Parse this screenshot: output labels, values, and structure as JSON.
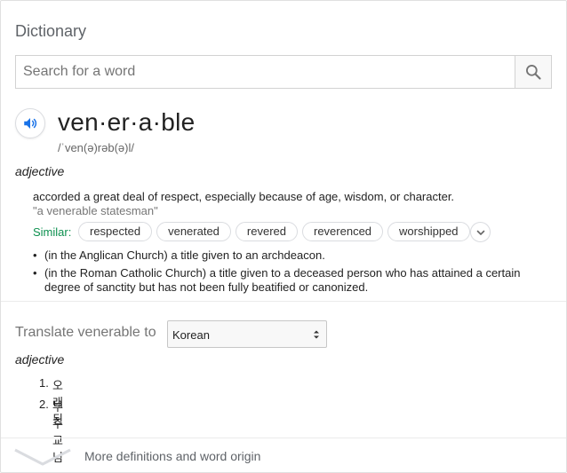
{
  "card": {
    "title": "Dictionary"
  },
  "search": {
    "placeholder": "Search for a word",
    "value": ""
  },
  "entry": {
    "headword": "ven·er·a·ble",
    "phonetic": "/ˈven(ə)rəb(ə)l/",
    "part_of_speech": "adjective",
    "definition": "accorded a great deal of respect, especially because of age, wisdom, or character.",
    "example": "\"a venerable statesman\"",
    "similar_label": "Similar:",
    "similar": [
      "respected",
      "venerated",
      "revered",
      "reverenced",
      "worshipped"
    ],
    "subsenses": [
      "(in the Anglican Church) a title given to an archdeacon.",
      "(in the Roman Catholic Church) a title given to a deceased person who has attained a certain",
      "degree of sanctity but has not been fully beatified or canonized."
    ]
  },
  "translate": {
    "label": "Translate venerable to",
    "language": "Korean",
    "part_of_speech": "adjective",
    "items": [
      {
        "num": "1.",
        "text": "오래된"
      },
      {
        "num": "2.",
        "text": "부주교님"
      }
    ]
  },
  "footer": {
    "more_label": "More definitions and word origin"
  },
  "colors": {
    "accent_blue": "#1a73e8",
    "similar_green": "#0d904f",
    "muted": "#757575"
  },
  "icons": [
    "search-icon",
    "speaker-icon",
    "chevron-down-icon",
    "select-arrows-icon"
  ]
}
